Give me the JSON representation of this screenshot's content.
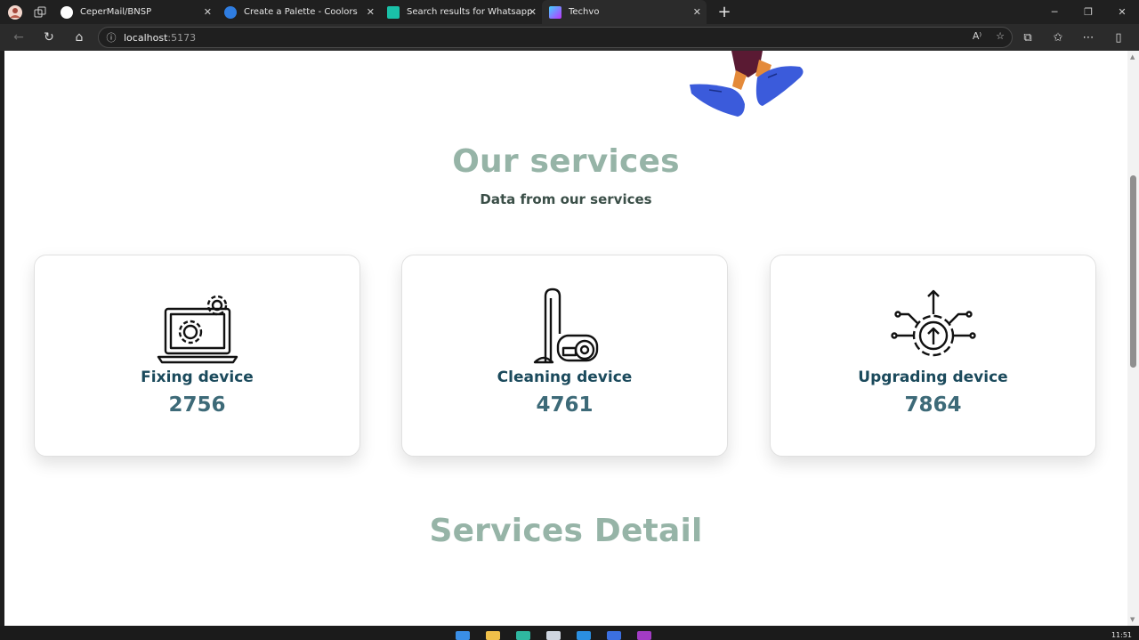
{
  "browser": {
    "tabs": [
      {
        "title": "CeperMail/BNSP",
        "icon": "github-icon"
      },
      {
        "title": "Create a Palette - Coolors",
        "icon": "coolors-icon"
      },
      {
        "title": "Search results for Whatsapp - Fla",
        "icon": "flaticon-icon"
      },
      {
        "title": "Techvo",
        "icon": "vite-icon",
        "active": true
      }
    ],
    "address": {
      "host": "localhost",
      "port": ":5173"
    },
    "close_glyph": "✕",
    "new_tab_glyph": "+"
  },
  "page": {
    "services_title": "Our services",
    "services_subtitle": "Data from our services",
    "cards": [
      {
        "label": "Fixing device",
        "value": "2756",
        "icon": "laptop-gears-icon"
      },
      {
        "label": "Cleaning device",
        "value": "4761",
        "icon": "vacuum-cleaner-icon"
      },
      {
        "label": "Upgrading device",
        "value": "7864",
        "icon": "upgrade-gear-icon"
      }
    ],
    "detail_title": "Services Detail"
  },
  "taskbar": {
    "time": "11:51"
  },
  "colors": {
    "title_green": "#96b4a7",
    "card_label": "#1b4a5c",
    "card_value": "#3d6a78"
  }
}
